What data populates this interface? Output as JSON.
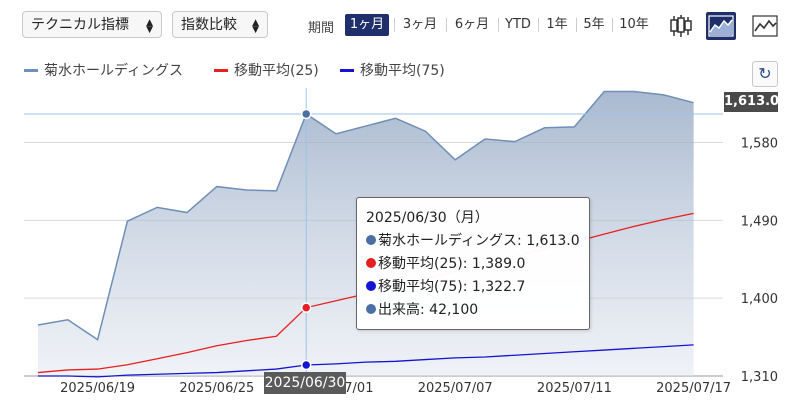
{
  "toolbar": {
    "technical_select": "テクニカル指標",
    "compare_select": "指数比較",
    "period_label": "期間",
    "periods": [
      "1ヶ月",
      "3ヶ月",
      "6ヶ月",
      "YTD",
      "1年",
      "5年",
      "10年"
    ],
    "active_period": "1ヶ月",
    "chart_type_icons": [
      "candlestick-icon",
      "area-chart-icon",
      "line-chart-icon"
    ],
    "active_chart_type": "area-chart-icon"
  },
  "legend": [
    {
      "name": "菊水ホールディングス",
      "color": "#6e8fb8"
    },
    {
      "name": "移動平均(25)",
      "color": "#e62020"
    },
    {
      "name": "移動平均(75)",
      "color": "#1414d2"
    }
  ],
  "refresh_icon": "refresh-icon",
  "chart_data": {
    "type": "area",
    "x": [
      "2025/06/17",
      "2025/06/18",
      "2025/06/19",
      "2025/06/20",
      "2025/06/23",
      "2025/06/24",
      "2025/06/25",
      "2025/06/26",
      "2025/06/27",
      "2025/06/30",
      "2025/07/01",
      "2025/07/02",
      "2025/07/03",
      "2025/07/04",
      "2025/07/07",
      "2025/07/08",
      "2025/07/09",
      "2025/07/10",
      "2025/07/11",
      "2025/07/14",
      "2025/07/15",
      "2025/07/16",
      "2025/07/17"
    ],
    "series": [
      {
        "name": "菊水ホールディングス",
        "type": "area",
        "color": "#6e8fb8",
        "values": [
          1369,
          1375,
          1352,
          1489,
          1505,
          1499,
          1529,
          1525,
          1524,
          1613,
          1590,
          1599,
          1608,
          1593,
          1560,
          1584,
          1581,
          1597,
          1598,
          1639,
          1639,
          1635,
          1626
        ]
      },
      {
        "name": "移動平均(25)",
        "type": "line",
        "color": "#e62020",
        "values": [
          1314,
          1317,
          1318,
          1323,
          1330,
          1337,
          1345,
          1351,
          1356,
          1389,
          1397,
          1405,
          1414,
          1422,
          1431,
          1440,
          1448,
          1457,
          1465,
          1474,
          1483,
          1491,
          1498
        ]
      },
      {
        "name": "移動平均(75)",
        "type": "line",
        "color": "#1414d2",
        "values": [
          1310,
          1310,
          1309,
          1311,
          1312,
          1313,
          1314,
          1316,
          1318,
          1322.7,
          1324,
          1326,
          1327,
          1329,
          1331,
          1332,
          1334,
          1336,
          1338,
          1340,
          1342,
          1344,
          1346
        ]
      }
    ],
    "xtick_labels": [
      "2025/06/19",
      "2025/06/25",
      "2025/07/01",
      "2025/07/07",
      "2025/07/11",
      "2025/07/17"
    ],
    "ytick_labels": [
      1310,
      1400,
      1490,
      1580
    ],
    "ylim": [
      1310,
      1643
    ],
    "grid": true,
    "y_axis_side": "right",
    "legend_position": "top-left",
    "current_value_label": "1,613.0",
    "hover": {
      "x_label": "2025/06/30",
      "date": "2025/06/30（月）",
      "rows": [
        {
          "label": "菊水ホールディングス",
          "value": "1,613.0",
          "color": "#4a6fa5"
        },
        {
          "label": "移動平均(25)",
          "value": "1,389.0",
          "color": "#e62020"
        },
        {
          "label": "移動平均(75)",
          "value": "1,322.7",
          "color": "#1414d2"
        },
        {
          "label": "出来高",
          "value": "42,100",
          "color": "#4a6fa5"
        }
      ]
    }
  }
}
